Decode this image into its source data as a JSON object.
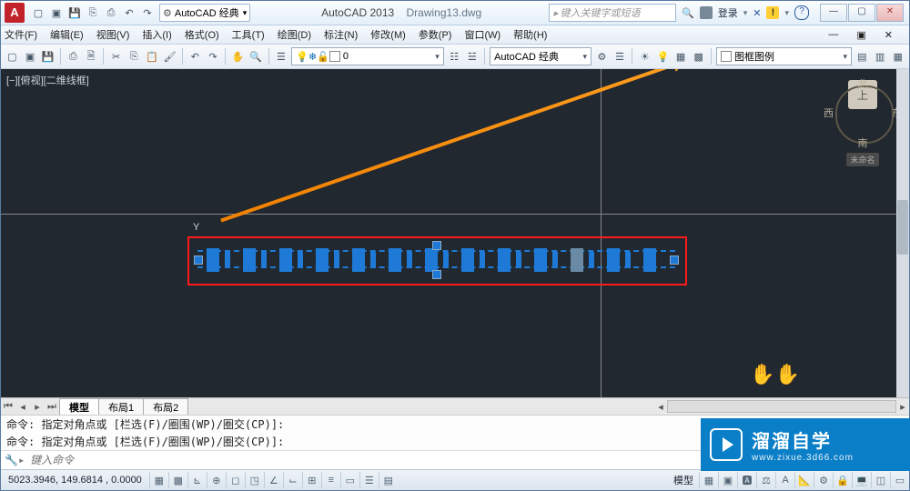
{
  "title": {
    "app": "AutoCAD 2013",
    "doc": "Drawing13.dwg"
  },
  "search_placeholder": "键入关键字或短语",
  "workspace": "AutoCAD 经典",
  "login": "登录",
  "menus": [
    "文件(F)",
    "编辑(E)",
    "视图(V)",
    "插入(I)",
    "格式(O)",
    "工具(T)",
    "绘图(D)",
    "标注(N)",
    "修改(M)",
    "参数(P)",
    "窗口(W)",
    "帮助(H)"
  ],
  "layer_combo": "0",
  "ws_combo2": "AutoCAD 经典",
  "legend_combo": "图框图例",
  "viewport_label": "[−][俯视][二维线框]",
  "nav": {
    "n": "北",
    "s": "南",
    "e": "东",
    "w": "西",
    "face": "上",
    "wcs": "未命名"
  },
  "y_label": "Y",
  "tabs": {
    "model": "模型",
    "l1": "布局1",
    "l2": "布局2"
  },
  "cmd": {
    "h1": "命令: 指定对角点或 [栏选(F)/圈围(WP)/圈交(CP)]:",
    "h2": "命令: 指定对角点或 [栏选(F)/圈围(WP)/圈交(CP)]:",
    "placeholder": "键入命令"
  },
  "coords": "5023.3946, 149.6814 , 0.0000",
  "status_ms": "模型",
  "brand": {
    "t1": "溜溜自学",
    "t2": "www.zixue.3d66.com"
  }
}
